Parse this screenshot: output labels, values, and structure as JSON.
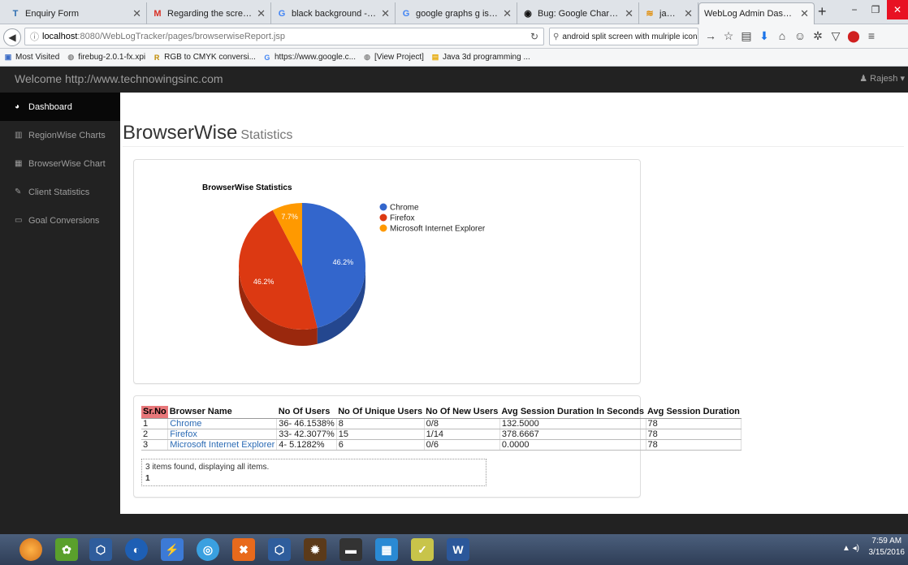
{
  "browser": {
    "tabs": [
      {
        "title": "Enquiry Form",
        "icon": "T",
        "icon_color": "#2b6cb0"
      },
      {
        "title": "Regarding the screensh...",
        "icon": "M",
        "icon_color": "#d93025"
      },
      {
        "title": "black background - Goo...",
        "icon": "G",
        "icon_color": "#4285f4"
      },
      {
        "title": "google graphs g is unde...",
        "icon": "G",
        "icon_color": "#4285f4"
      },
      {
        "title": "Bug: Google Charts will ...",
        "icon": "◉",
        "icon_color": "#111111"
      },
      {
        "title": "javascript - Trouble with...",
        "icon": "≋",
        "icon_color": "#e08a00"
      },
      {
        "title": "WebLog Admin Dashboard",
        "icon": "",
        "icon_color": "#ffffff"
      }
    ],
    "url_host": "localhost",
    "url_rest": ":8080/WebLogTracker/pages/browserwiseReport.jsp",
    "search_value": "android split screen with mulriple icons",
    "bookmarks": [
      {
        "label": "Most Visited",
        "icon": "▣",
        "icon_color": "#3b6bc5"
      },
      {
        "label": "firebug-2.0.1-fx.xpi",
        "icon": "◍",
        "icon_color": "#888888"
      },
      {
        "label": "RGB to CMYK conversi...",
        "icon": "R",
        "icon_color": "#c08a00"
      },
      {
        "label": "https://www.google.c...",
        "icon": "G",
        "icon_color": "#4285f4"
      },
      {
        "label": "[View Project]",
        "icon": "◍",
        "icon_color": "#888888"
      },
      {
        "label": "Java 3d programming ...",
        "icon": "▤",
        "icon_color": "#e6a800"
      }
    ]
  },
  "app": {
    "brand": "Welcome http://www.technowingsinc.com",
    "user": "Rajesh",
    "sidebar": [
      {
        "label": "Dashboard",
        "icon": "dashboard-icon",
        "glyph": "◕",
        "active": true
      },
      {
        "label": "RegionWise Charts",
        "icon": "bar-chart-icon",
        "glyph": "▥",
        "active": false
      },
      {
        "label": "BrowserWise Chart",
        "icon": "table-icon",
        "glyph": "▦",
        "active": false
      },
      {
        "label": "Client Statistics",
        "icon": "edit-icon",
        "glyph": "✎",
        "active": false
      },
      {
        "label": "Goal Conversions",
        "icon": "monitor-icon",
        "glyph": "▭",
        "active": false
      }
    ],
    "page_title": "BrowserWise",
    "page_subtitle": "Statistics"
  },
  "chart_data": {
    "type": "pie",
    "title": "BrowserWise Statistics",
    "categories": [
      "Chrome",
      "Firefox",
      "Microsoft Internet Explorer"
    ],
    "values": [
      46.2,
      46.2,
      7.7
    ],
    "value_labels": [
      "46.2%",
      "46.2%",
      "7.7%"
    ],
    "colors": [
      "#3366cc",
      "#dc3912",
      "#ff9900"
    ],
    "is3D": true,
    "legend_position": "right"
  },
  "table": {
    "headers": [
      "Sr.No",
      "Browser Name",
      "No Of Users",
      "No Of Unique Users",
      "No Of New Users",
      "Avg Session Duration In Seconds",
      "Avg Session Duration"
    ],
    "rows": [
      [
        "1",
        "Chrome",
        "36- 46.1538%",
        "8",
        "0/8",
        "132.5000",
        "78"
      ],
      [
        "2",
        "Firefox",
        "33- 42.3077%",
        "15",
        "1/14",
        "378.6667",
        "78"
      ],
      [
        "3",
        "Microsoft Internet Explorer",
        "4- 5.1282%",
        "6",
        "0/6",
        "0.0000",
        "78"
      ]
    ],
    "summary": "3 items found, displaying all items.",
    "page": "1"
  },
  "taskbar": {
    "time": "7:59 AM",
    "date": "3/15/2016"
  }
}
